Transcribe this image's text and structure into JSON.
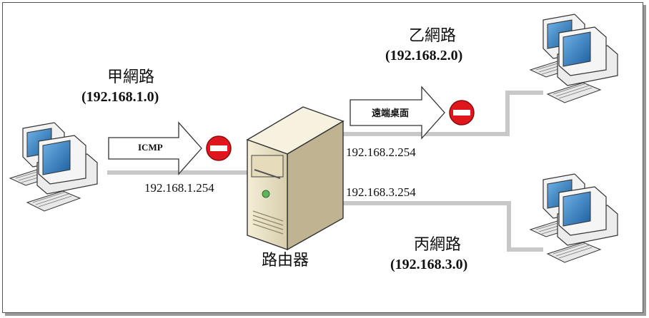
{
  "networks": {
    "a": {
      "name": "甲網路",
      "subnet": "(192.168.1.0)"
    },
    "b": {
      "name": "乙網路",
      "subnet": "(192.168.2.0)"
    },
    "c": {
      "name": "丙網路",
      "subnet": "(192.168.3.0)"
    }
  },
  "router": {
    "name": "路由器",
    "ip_a": "192.168.1.254",
    "ip_b": "192.168.2.254",
    "ip_c": "192.168.3.254"
  },
  "blocked_traffic": {
    "icmp": "ICMP",
    "remote_desktop": "遠端桌面"
  },
  "colors": {
    "link": "#c8c8c8",
    "block": "#e0161d",
    "computer_body": "#ececec",
    "screen": "#2f77b8"
  },
  "icons": [
    "computer-icon",
    "server-icon",
    "no-entry-icon",
    "arrow-icon"
  ]
}
